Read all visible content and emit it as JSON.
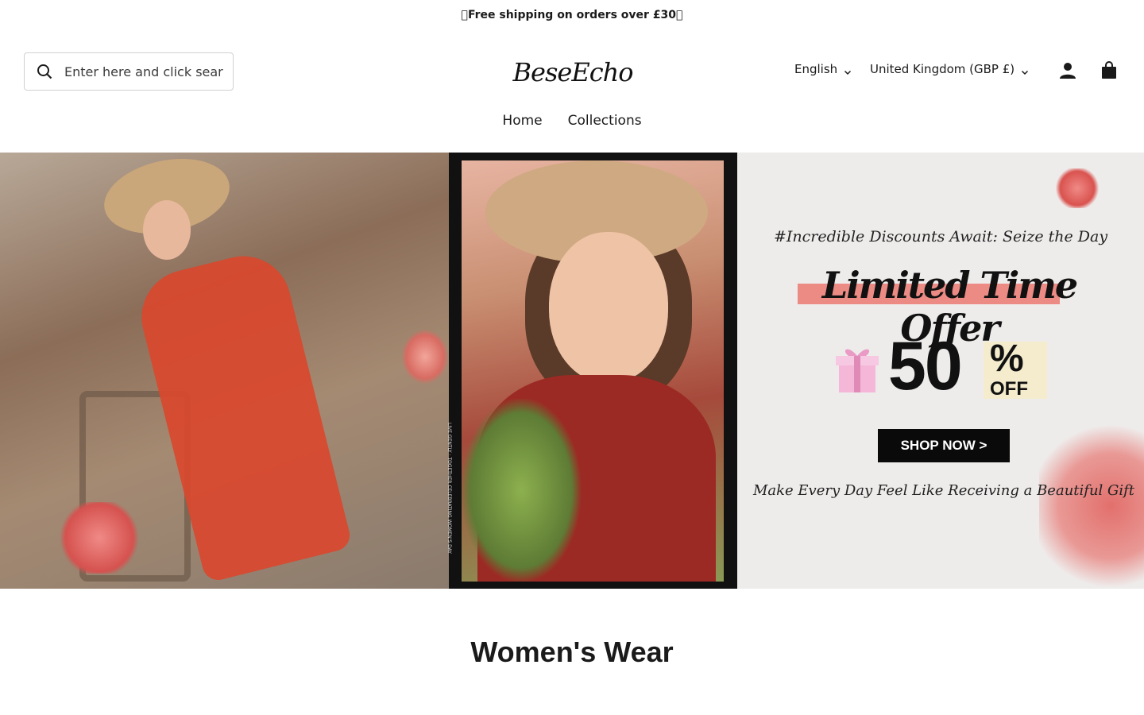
{
  "announcement": {
    "text": "\u0000Free shipping on orders over £30\u0000"
  },
  "header": {
    "search": {
      "placeholder": "Enter here and click search"
    },
    "logo": {
      "text": "BeseEcho"
    },
    "language": {
      "label": "English"
    },
    "country": {
      "label": "United Kingdom (GBP £)"
    }
  },
  "nav": {
    "items": [
      {
        "label": "Home"
      },
      {
        "label": "Collections"
      }
    ]
  },
  "hero": {
    "tagline": "#Incredible Discounts Await: Seize the Day",
    "title": "Limited Time Offer",
    "discount": "50",
    "percent": "%",
    "off": "OFF",
    "cta": "SHOP NOW >",
    "subtitle": "Make Every Day Feel Like Receiving a Beautiful Gift",
    "side_text": "LIVE GENTLY · TOGETHER CELEBRATING WOMEN'S DAY"
  },
  "section": {
    "title": "Women's Wear"
  },
  "colors": {
    "highlight": "#ec8a84",
    "button": "#0a0a0a",
    "text": "#1a1a1a"
  }
}
